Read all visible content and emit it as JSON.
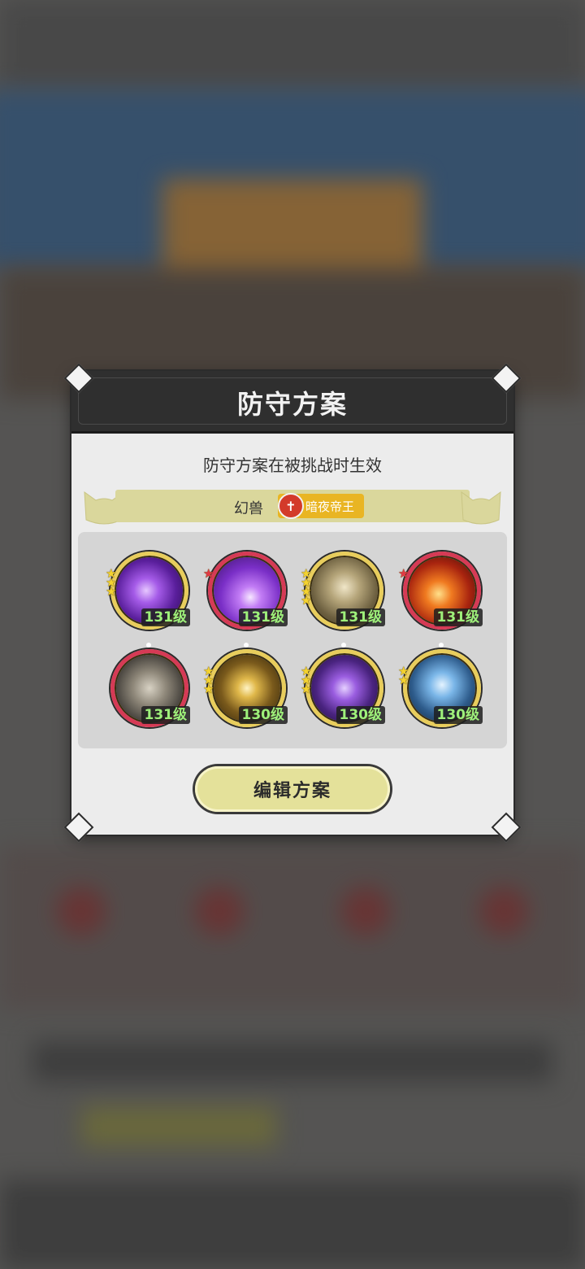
{
  "dialog": {
    "title": "防守方案",
    "subtitle": "防守方案在被挑战时生效",
    "beast_label": "幻兽",
    "beast_icon": "beast-emblem-icon",
    "beast_name": "暗夜帝王",
    "edit_button": "编辑方案",
    "close_icons": [
      "corner-ornament-icon"
    ]
  },
  "skills": [
    {
      "name": "skill-violet-heart",
      "level": "131级",
      "stars": 3,
      "star_color": "gold",
      "frame": "gold"
    },
    {
      "name": "skill-violet-orb",
      "level": "131级",
      "stars": 1,
      "star_color": "red",
      "frame": "red"
    },
    {
      "name": "skill-dark-hand",
      "level": "131级",
      "stars": 4,
      "star_color": "gold",
      "frame": "gold"
    },
    {
      "name": "skill-fire-slash",
      "level": "131级",
      "stars": 1,
      "star_color": "red",
      "frame": "red"
    },
    {
      "name": "skill-stone-guard",
      "level": "131级",
      "stars": 0,
      "star_color": "none",
      "frame": "red"
    },
    {
      "name": "skill-golden-vortex",
      "level": "130级",
      "stars": 3,
      "star_color": "gold",
      "frame": "gold"
    },
    {
      "name": "skill-shadow-orb",
      "level": "130级",
      "stars": 3,
      "star_color": "gold",
      "frame": "gold"
    },
    {
      "name": "skill-ice-crown",
      "level": "130级",
      "stars": 2,
      "star_color": "gold",
      "frame": "gold"
    }
  ],
  "colors": {
    "header": "#2f2f2f",
    "panel": "#ececec",
    "banner": "#dad79c",
    "button": "#e4e19a",
    "gold_frame": "#e8cd5c",
    "red_frame": "#d63a55",
    "level_text": "#9ef07a"
  }
}
